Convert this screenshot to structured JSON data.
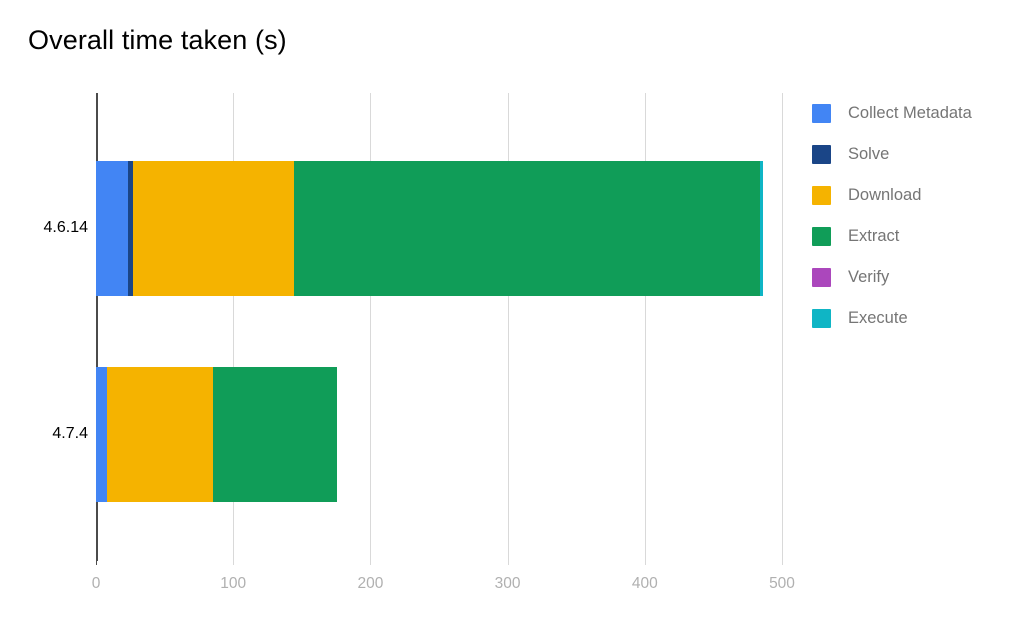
{
  "chart_data": {
    "type": "bar",
    "orientation": "horizontal",
    "stacked": true,
    "title": "Overall time taken (s)",
    "xlabel": "",
    "ylabel": "",
    "categories": [
      "4.6.14",
      "4.7.4"
    ],
    "xlim": [
      0,
      500
    ],
    "xticks": [
      0,
      100,
      200,
      300,
      400,
      500
    ],
    "xtick_labels": [
      "0",
      "100",
      "200",
      "300",
      "400",
      "500"
    ],
    "grid": true,
    "legend_position": "right",
    "series": [
      {
        "name": "Collect Metadata",
        "color": "#4285f4",
        "values": [
          23,
          8
        ]
      },
      {
        "name": "Solve",
        "color": "#1a4587",
        "values": [
          4,
          0
        ]
      },
      {
        "name": "Download",
        "color": "#f5b300",
        "values": [
          117,
          77
        ]
      },
      {
        "name": "Extract",
        "color": "#109d58",
        "values": [
          340,
          91
        ]
      },
      {
        "name": "Verify",
        "color": "#ab47bc",
        "values": [
          0,
          0
        ]
      },
      {
        "name": "Execute",
        "color": "#0fb5c5",
        "values": [
          2,
          0
        ]
      }
    ],
    "totals": [
      486,
      176
    ]
  },
  "colors": {
    "background": "#ffffff",
    "axis": "#4b4b4b",
    "gridline": "#d9d9d9",
    "tick_label": "#b0b0b0",
    "category_label": "#000000",
    "legend_label": "#757575",
    "title": "#000000"
  }
}
